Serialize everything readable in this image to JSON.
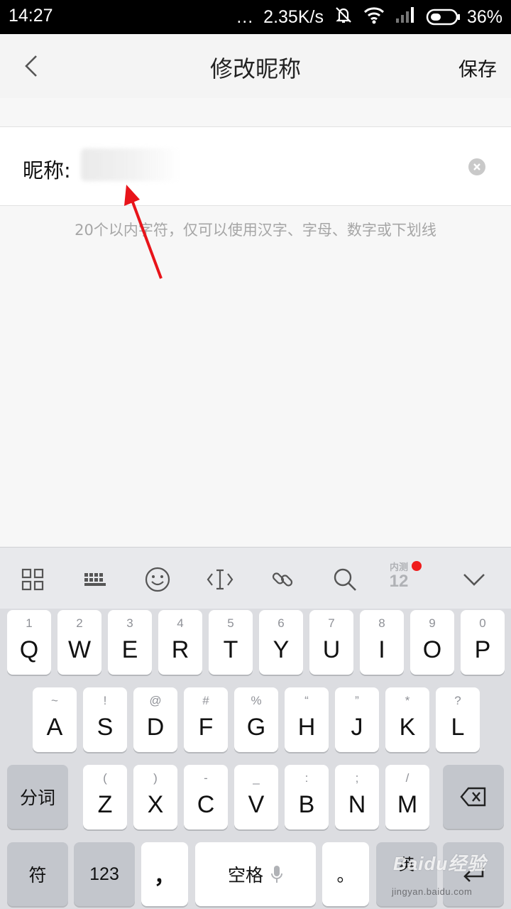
{
  "status_bar": {
    "time": "14:27",
    "dots": "...",
    "network_speed": "2.35K/s",
    "battery": "36%"
  },
  "header": {
    "title": "修改昵称",
    "save_label": "保存"
  },
  "form": {
    "label": "昵称:",
    "value": "",
    "hint": "20个以内字符，仅可以使用汉字、字母、数字或下划线"
  },
  "keyboard": {
    "toolbar": {
      "icons": [
        "grid-icon",
        "keyboard-icon",
        "emoji-icon",
        "cursor-icon",
        "link-icon",
        "search-icon",
        "beta-badge",
        "chevron-down-icon"
      ],
      "badge_top": "内测",
      "badge_num": "12"
    },
    "row1": [
      {
        "sup": "1",
        "main": "Q"
      },
      {
        "sup": "2",
        "main": "W"
      },
      {
        "sup": "3",
        "main": "E"
      },
      {
        "sup": "4",
        "main": "R"
      },
      {
        "sup": "5",
        "main": "T"
      },
      {
        "sup": "6",
        "main": "Y"
      },
      {
        "sup": "7",
        "main": "U"
      },
      {
        "sup": "8",
        "main": "I"
      },
      {
        "sup": "9",
        "main": "O"
      },
      {
        "sup": "0",
        "main": "P"
      }
    ],
    "row2": [
      {
        "sup": "~",
        "main": "A"
      },
      {
        "sup": "!",
        "main": "S"
      },
      {
        "sup": "@",
        "main": "D"
      },
      {
        "sup": "#",
        "main": "F"
      },
      {
        "sup": "%",
        "main": "G"
      },
      {
        "sup": "“",
        "main": "H"
      },
      {
        "sup": "”",
        "main": "J"
      },
      {
        "sup": "*",
        "main": "K"
      },
      {
        "sup": "?",
        "main": "L"
      }
    ],
    "row3": [
      {
        "sup": "(",
        "main": "Z"
      },
      {
        "sup": ")",
        "main": "X"
      },
      {
        "sup": "-",
        "main": "C"
      },
      {
        "sup": "_",
        "main": "V"
      },
      {
        "sup": ":",
        "main": "B"
      },
      {
        "sup": ";",
        "main": "N"
      },
      {
        "sup": "/",
        "main": "M"
      }
    ],
    "segment_label": "分词",
    "symbols_label": "符",
    "numbers_label": "123",
    "comma_label": "，",
    "space_label": "空格",
    "period_label": "。",
    "lang_label": "英"
  },
  "watermark": {
    "brand": "Baidu经验",
    "url": "jingyan.baidu.com"
  },
  "colors": {
    "accent_red": "#ef1c1c",
    "keyboard_bg": "#dcdde1"
  }
}
